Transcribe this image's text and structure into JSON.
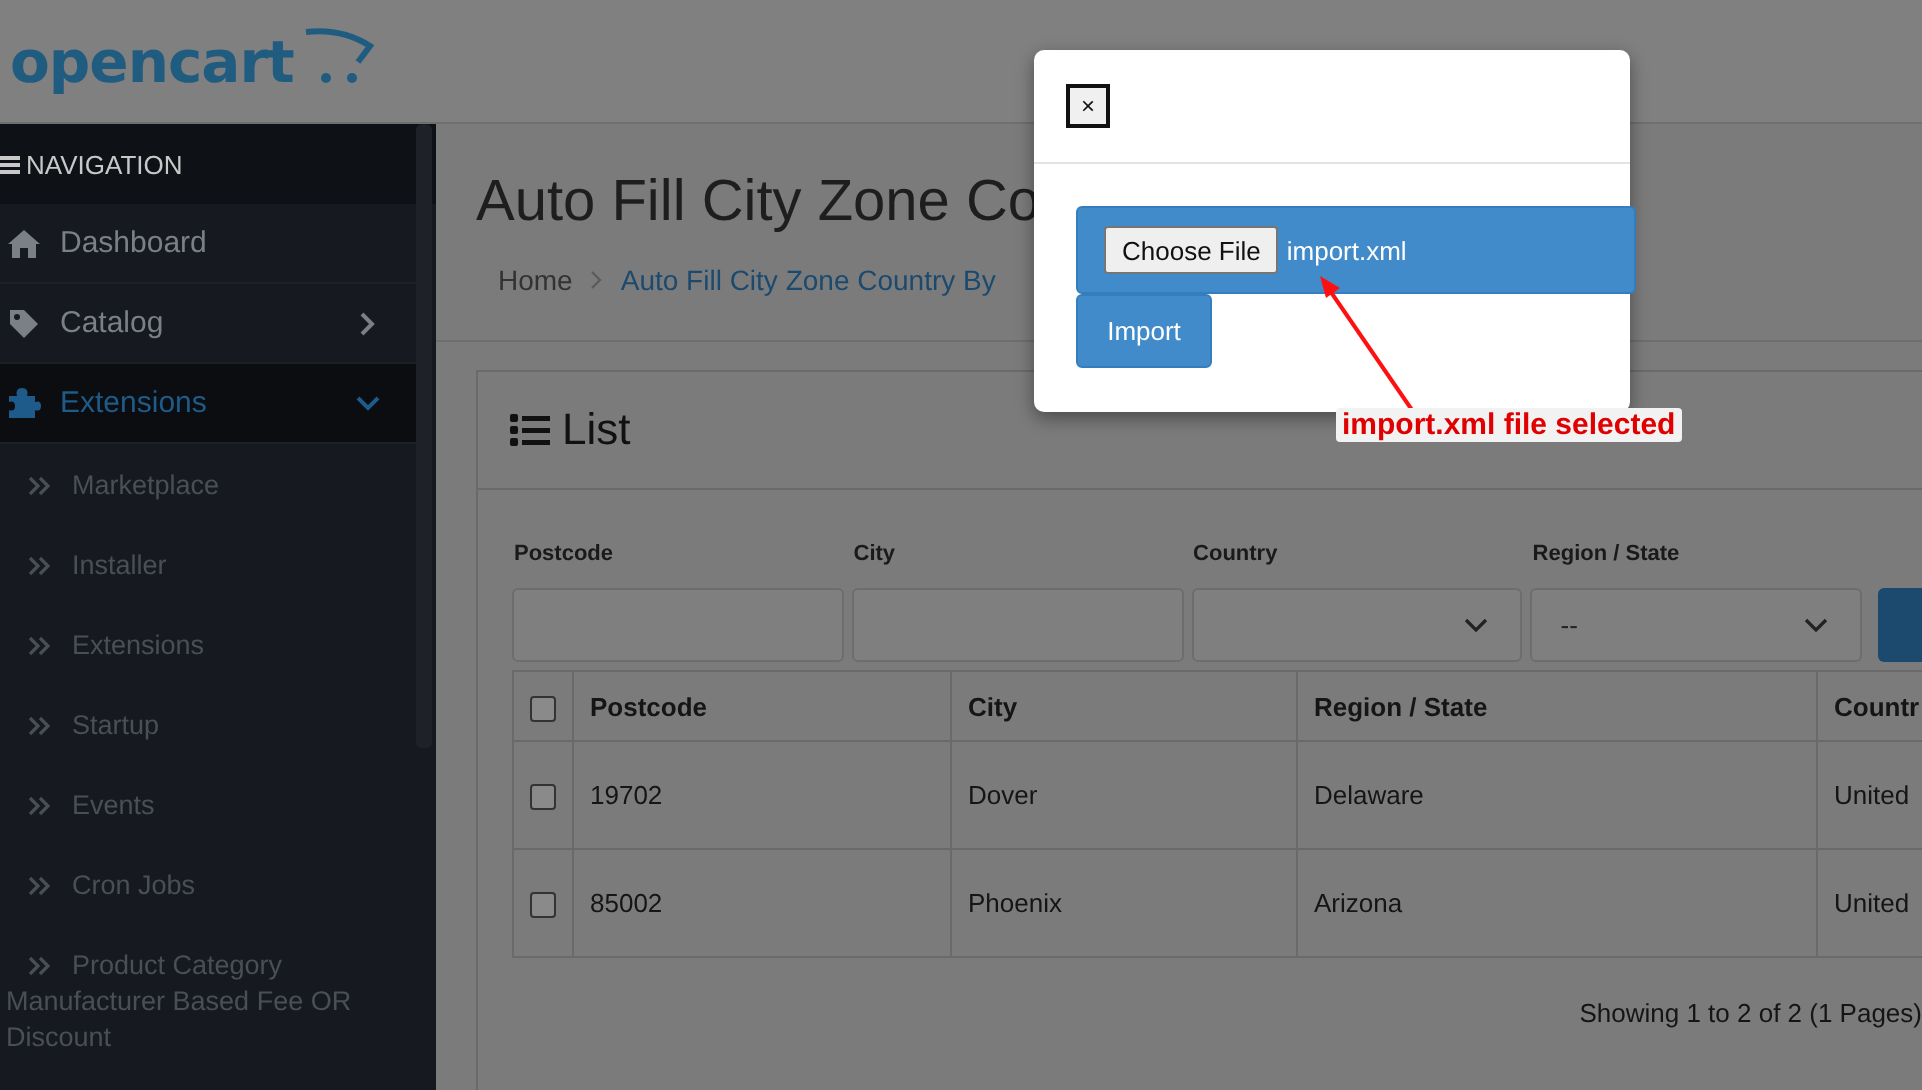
{
  "header": {
    "logo": "opencart"
  },
  "navigation": {
    "title": "NAVIGATION",
    "items": [
      {
        "label": "Dashboard",
        "kind": "link",
        "selected": false
      },
      {
        "label": "Catalog",
        "kind": "group",
        "selected": false,
        "expanded": false
      },
      {
        "label": "Extensions",
        "kind": "group",
        "selected": true,
        "expanded": true,
        "children": [
          {
            "label": "Marketplace"
          },
          {
            "label": "Installer"
          },
          {
            "label": "Extensions"
          },
          {
            "label": "Startup"
          },
          {
            "label": "Events"
          },
          {
            "label": "Cron Jobs"
          },
          {
            "label": "Product Category Manufacturer Based Fee OR Discount"
          }
        ]
      }
    ]
  },
  "page": {
    "title": "Auto Fill City Zone Co",
    "breadcrumb": [
      "Home",
      "Auto Fill City Zone Country By"
    ]
  },
  "panel": {
    "title": "List",
    "filters": [
      {
        "label": "Postcode",
        "kind": "input"
      },
      {
        "label": "City",
        "kind": "input"
      },
      {
        "label": "Country",
        "kind": "select"
      },
      {
        "label": "Region / State",
        "kind": "select",
        "value": "--"
      }
    ],
    "table": {
      "all_checked": false,
      "columns": [
        "Postcode",
        "City",
        "Region / State",
        "Countr"
      ],
      "rows": [
        {
          "checked": false,
          "cells": [
            "19702",
            "Dover",
            "Delaware",
            "United"
          ]
        },
        {
          "checked": false,
          "cells": [
            "85002",
            "Phoenix",
            "Arizona",
            "United"
          ]
        }
      ]
    },
    "pagination": "Showing 1 to 2 of 2 (1 Pages)"
  },
  "modal": {
    "close": "×",
    "choose_button": "Choose File",
    "file_name": "import.xml",
    "import_button": "Import"
  },
  "annotation": {
    "text": "import.xml file selected"
  }
}
